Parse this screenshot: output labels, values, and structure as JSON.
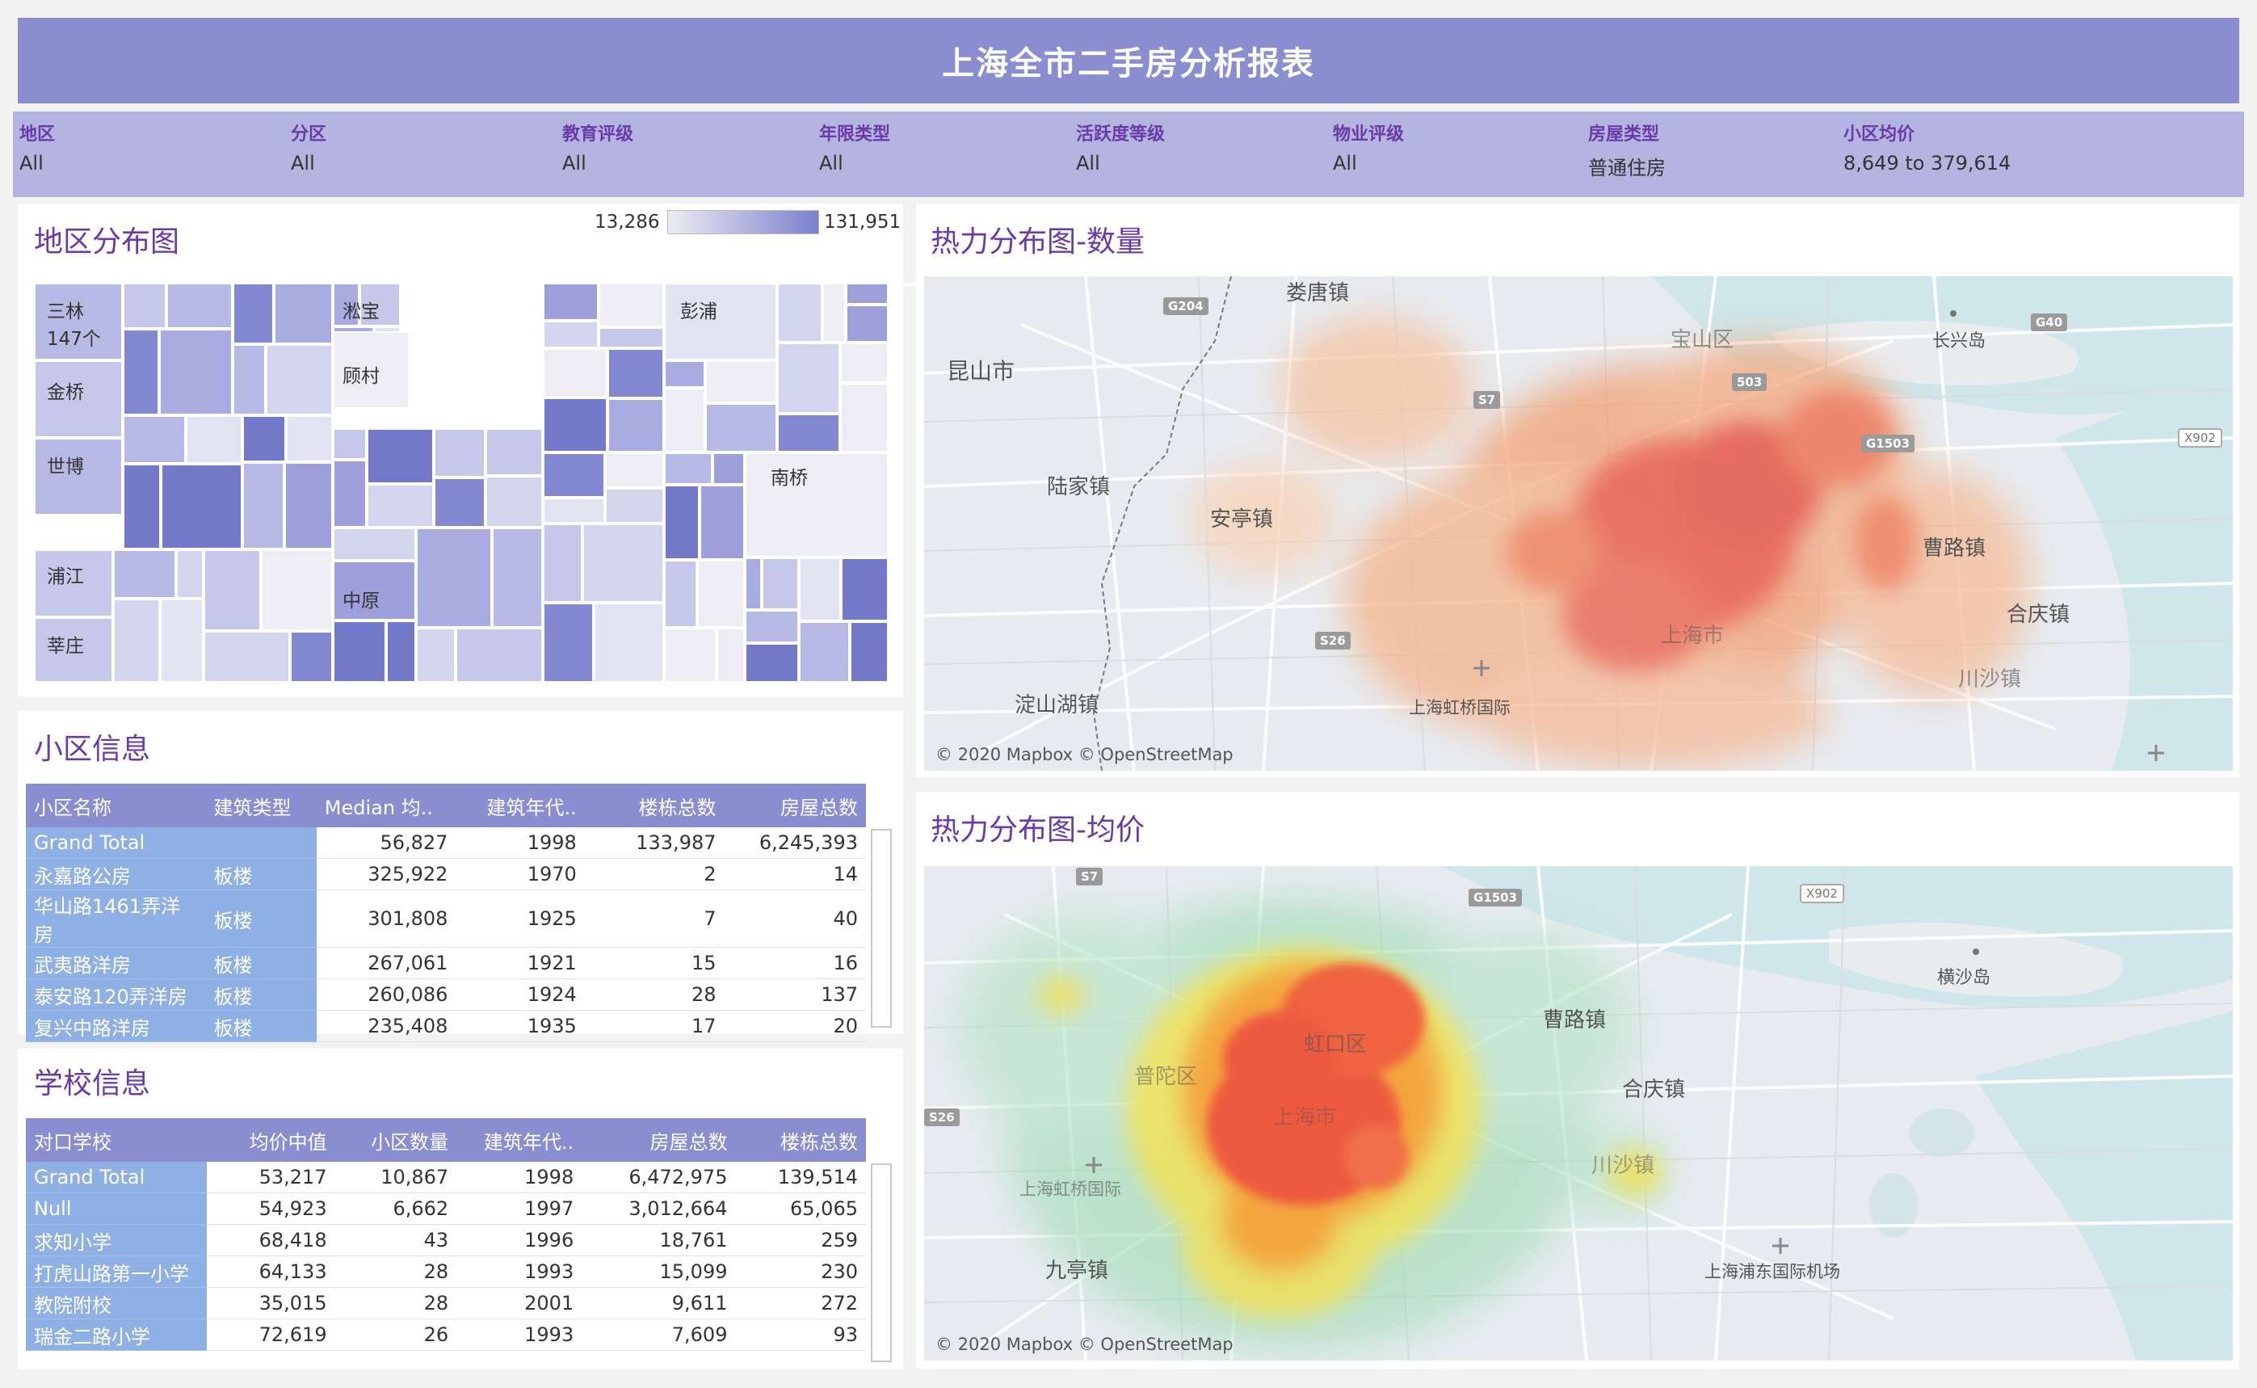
{
  "header": {
    "title": "上海全市二手房分析报表"
  },
  "filters": [
    {
      "label": "地区",
      "value": "All"
    },
    {
      "label": "分区",
      "value": "All"
    },
    {
      "label": "教育评级",
      "value": "All"
    },
    {
      "label": "年限类型",
      "value": "All"
    },
    {
      "label": "活跃度等级",
      "value": "All"
    },
    {
      "label": "物业评级",
      "value": "All"
    },
    {
      "label": "房屋类型",
      "value": "普通住房"
    },
    {
      "label": "小区均价",
      "value": "8,649 to 379,614"
    }
  ],
  "treemap": {
    "title": "地区分布图",
    "legend_min": "13,286",
    "legend_max": "131,951",
    "labels": {
      "sanlin": "三林\n147个",
      "jinqiao": "金桥",
      "shibo": "世博",
      "pujiang": "浦江",
      "xinzhuang": "莘庄",
      "songbao": "淞宝",
      "gucun": "顾村",
      "zhongyuan": "中原",
      "pengpu": "彭浦",
      "nanqiao": "南桥"
    }
  },
  "community": {
    "title": "小区信息",
    "columns": [
      "小区名称",
      "建筑类型",
      "Median 均..",
      "建筑年代..",
      "楼栋总数",
      "房屋总数"
    ],
    "rows": [
      [
        "Grand Total",
        "",
        "56,827",
        "1998",
        "133,987",
        "6,245,393"
      ],
      [
        "永嘉路公房",
        "板楼",
        "325,922",
        "1970",
        "2",
        "14"
      ],
      [
        "华山路1461弄洋房",
        "板楼",
        "301,808",
        "1925",
        "7",
        "40"
      ],
      [
        "武夷路洋房",
        "板楼",
        "267,061",
        "1921",
        "15",
        "16"
      ],
      [
        "泰安路120弄洋房",
        "板楼",
        "260,086",
        "1924",
        "28",
        "137"
      ],
      [
        "复兴中路洋房",
        "板楼",
        "235,408",
        "1935",
        "17",
        "20"
      ]
    ]
  },
  "school": {
    "title": "学校信息",
    "columns": [
      "对口学校",
      "均价中值",
      "小区数量",
      "建筑年代..",
      "房屋总数",
      "楼栋总数"
    ],
    "rows": [
      [
        "Grand Total",
        "53,217",
        "10,867",
        "1998",
        "6,472,975",
        "139,514"
      ],
      [
        "Null",
        "54,923",
        "6,662",
        "1997",
        "3,012,664",
        "65,065"
      ],
      [
        "求知小学",
        "68,418",
        "43",
        "1996",
        "18,761",
        "259"
      ],
      [
        "打虎山路第一小学",
        "64,133",
        "28",
        "1993",
        "15,099",
        "230"
      ],
      [
        "教院附校",
        "35,015",
        "28",
        "2001",
        "9,611",
        "272"
      ],
      [
        "瑞金二路小学",
        "72,619",
        "26",
        "1993",
        "7,609",
        "93"
      ]
    ]
  },
  "map_count": {
    "title": "热力分布图-数量",
    "places": [
      "娄唐镇",
      "昆山市",
      "陆家镇",
      "安亭镇",
      "淀山湖镇",
      "长兴岛",
      "宝山区",
      "曹路镇",
      "合庆镇",
      "上海虹桥国际",
      "川沙镇",
      "上海市"
    ],
    "shields": [
      "G204",
      "S7",
      "G1503",
      "G40",
      "503",
      "S26"
    ],
    "shields_white": [
      "X902"
    ],
    "attribution": "© 2020 Mapbox © OpenStreetMap"
  },
  "map_price": {
    "title": "热力分布图-均价",
    "places": [
      "横沙岛",
      "曹路镇",
      "合庆镇",
      "上海虹桥国际",
      "上海浦东国际机场",
      "九亭镇",
      "川沙镇",
      "虹口区",
      "普陀区",
      "上海市"
    ],
    "shields": [
      "S7",
      "G1503",
      "S26"
    ],
    "shields_white": [
      "X902"
    ],
    "attribution": "© 2020 Mapbox © OpenStreetMap"
  },
  "colors": {
    "header": "#8a8dd0",
    "filter_bg": "#b3b5e0",
    "accent_text": "#6a3aa8",
    "table_header": "#8a8dd0",
    "row_header": "#8fb0e4"
  }
}
